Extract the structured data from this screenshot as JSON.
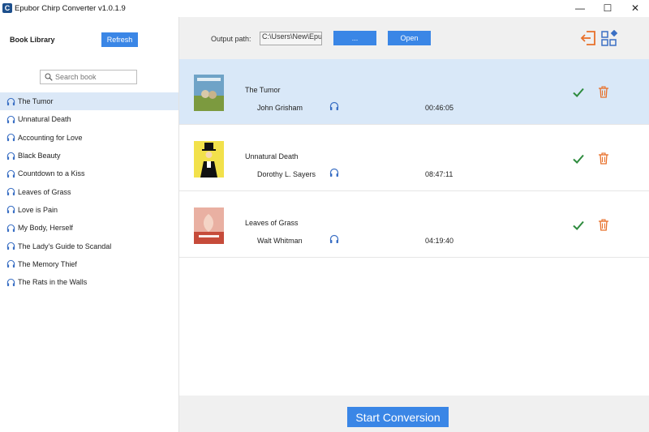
{
  "window": {
    "title": "Epubor Chirp Converter v1.0.1.9",
    "minimize_glyph": "—",
    "maximize_glyph": "☐",
    "close_glyph": "✕"
  },
  "sidebar": {
    "title": "Book Library",
    "refresh_label": "Refresh",
    "search_placeholder": "Search book",
    "items": [
      {
        "label": "The Tumor"
      },
      {
        "label": "Unnatural Death"
      },
      {
        "label": "Accounting for Love"
      },
      {
        "label": "Black Beauty"
      },
      {
        "label": "Countdown to a Kiss"
      },
      {
        "label": "Leaves of Grass"
      },
      {
        "label": "Love is Pain"
      },
      {
        "label": "My Body, Herself"
      },
      {
        "label": "The Lady's Guide to Scandal"
      },
      {
        "label": "The Memory Thief"
      },
      {
        "label": "The Rats in the Walls"
      }
    ],
    "selected_index": 0
  },
  "toolbar": {
    "output_label": "Output path:",
    "output_value": "C:\\Users\\New\\Epul",
    "browse_label": "...",
    "open_label": "Open"
  },
  "queue": [
    {
      "title": "The Tumor",
      "author": "John Grisham",
      "duration": "00:46:05",
      "selected": true
    },
    {
      "title": "Unnatural Death",
      "author": "Dorothy L. Sayers",
      "duration": "08:47:11",
      "selected": false
    },
    {
      "title": "Leaves of Grass",
      "author": "Walt Whitman",
      "duration": "04:19:40",
      "selected": false
    }
  ],
  "footer": {
    "start_label": "Start Conversion"
  },
  "colors": {
    "accent": "#3a86e6",
    "selected_bg": "#d9e8f8",
    "check": "#2e8b3e",
    "delete": "#e8702a",
    "export": "#e8702a"
  }
}
